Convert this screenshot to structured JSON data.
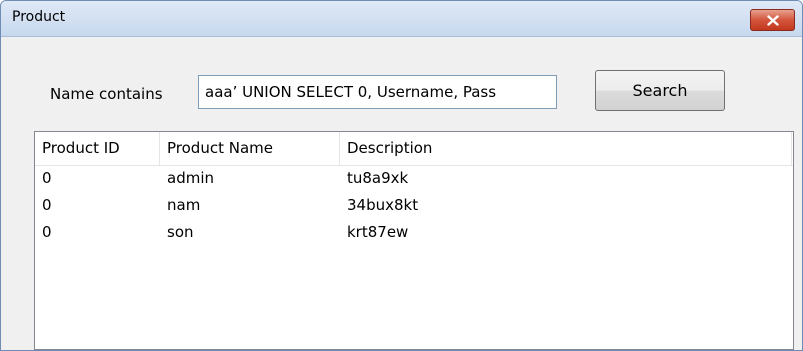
{
  "window": {
    "title": "Product",
    "close_icon": "close-x-icon"
  },
  "search": {
    "label": "Name contains",
    "value": "aaa’ UNION SELECT 0, Username, Pass",
    "button_label": "Search"
  },
  "table": {
    "columns": [
      "Product ID",
      "Product Name",
      "Description"
    ],
    "rows": [
      [
        "0",
        "admin",
        "tu8a9xk"
      ],
      [
        "0",
        "nam",
        "34bux8kt"
      ],
      [
        "0",
        "son",
        "krt87ew"
      ]
    ]
  }
}
